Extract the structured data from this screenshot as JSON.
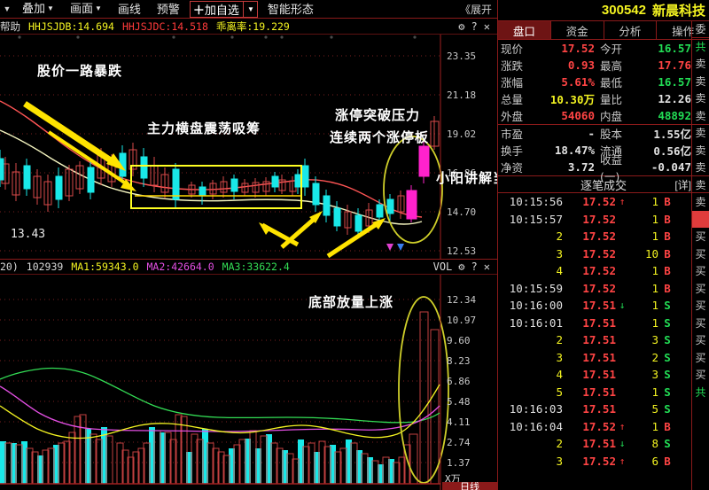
{
  "menu": {
    "left_caret": "▼",
    "items": [
      {
        "label": "叠加",
        "caret": "▼"
      },
      {
        "label": "画面",
        "caret": "▼"
      },
      {
        "label": "画线",
        "caret": ""
      },
      {
        "label": "预警",
        "caret": ""
      }
    ],
    "add_favorite": {
      "plus": "＋",
      "label": "加自选",
      "dropdown": "▼"
    },
    "smart_pattern": "智能形态",
    "expand": "《展开"
  },
  "indicator_line": {
    "help": "帮助",
    "items": [
      {
        "text": "HHJSJDB:14.694",
        "color": "yellow"
      },
      {
        "text": "HHJSJDC:14.518",
        "color": "red"
      },
      {
        "text": "乖离率:19.229",
        "color": "yellow"
      }
    ],
    "tools": [
      "gear-icon",
      "?",
      "✕"
    ]
  },
  "volume_header": {
    "period": "20)",
    "value": "102939",
    "ma1": "MA1:59343.0",
    "ma2": "MA2:42664.0",
    "ma3": "MA3:33622.4",
    "label": "VOL",
    "tools": [
      "gear-icon",
      "?",
      "✕"
    ]
  },
  "price_axis": [
    "23.35",
    "21.18",
    "19.02",
    "16.86",
    "14.70",
    "12.53"
  ],
  "volume_axis": [
    "12.34",
    "10.97",
    "9.60",
    "8.23",
    "6.86",
    "5.48",
    "4.11",
    "2.74",
    "1.37"
  ],
  "volume_axis_unit": "X万",
  "annotations": {
    "crash": "股价一路暴跌",
    "accumulation": "主力横盘震荡吸筹",
    "breakout_line1": "涨停突破压力",
    "breakout_line2": "连续两个涨停板",
    "bottom_volume": "底部放量上涨",
    "price_tag": "13.43",
    "watermark": "小阳讲解当日"
  },
  "day_tab": "日线",
  "right": {
    "stock": {
      "code": "300542",
      "name": "新晨科技"
    },
    "tabs": [
      {
        "label": "盘口",
        "active": true
      },
      {
        "label": "资金",
        "active": false
      },
      {
        "label": "分析",
        "active": false
      },
      {
        "label": "操作",
        "active": false
      }
    ],
    "quote_rows": [
      {
        "label": "现价",
        "value": "17.52",
        "vcolor": "red",
        "label2": "今开",
        "value2": "16.57",
        "vcolor2": "green"
      },
      {
        "label": "涨跌",
        "value": "0.93",
        "vcolor": "red",
        "label2": "最高",
        "value2": "17.76",
        "vcolor2": "red"
      },
      {
        "label": "涨幅",
        "value": "5.61%",
        "vcolor": "red",
        "label2": "最低",
        "value2": "16.57",
        "vcolor2": "green"
      },
      {
        "label": "总量",
        "value": "10.30万",
        "vcolor": "yellow",
        "label2": "量比",
        "value2": "12.26",
        "vcolor2": "white"
      },
      {
        "label": "外盘",
        "value": "54060",
        "vcolor": "red",
        "label2": "内盘",
        "value2": "48892",
        "vcolor2": "green"
      }
    ],
    "quote_rows2": [
      {
        "label": "市盈",
        "value": "-",
        "vcolor": "white",
        "label2": "股本",
        "value2": "1.55亿",
        "vcolor2": "white"
      },
      {
        "label": "换手",
        "value": "18.47%",
        "vcolor": "white",
        "label2": "流通",
        "value2": "0.56亿",
        "vcolor2": "white"
      },
      {
        "label": "净资",
        "value": "3.72",
        "vcolor": "white",
        "label2": "收益(一)",
        "value2": "-0.047",
        "vcolor2": "white"
      }
    ],
    "ticks_title": "逐笔成交",
    "ticks_detail": "[详]",
    "ticks": [
      {
        "time": "10:15:56",
        "is_seq": false,
        "price": "17.52",
        "arrow": "up",
        "vol": "1",
        "bs": "B"
      },
      {
        "time": "10:15:57",
        "is_seq": false,
        "price": "17.52",
        "arrow": "",
        "vol": "1",
        "bs": "B"
      },
      {
        "time": "2",
        "is_seq": true,
        "price": "17.52",
        "arrow": "",
        "vol": "1",
        "bs": "B"
      },
      {
        "time": "3",
        "is_seq": true,
        "price": "17.52",
        "arrow": "",
        "vol": "10",
        "bs": "B"
      },
      {
        "time": "4",
        "is_seq": true,
        "price": "17.52",
        "arrow": "",
        "vol": "1",
        "bs": "B"
      },
      {
        "time": "10:15:59",
        "is_seq": false,
        "price": "17.52",
        "arrow": "",
        "vol": "1",
        "bs": "B"
      },
      {
        "time": "10:16:00",
        "is_seq": false,
        "price": "17.51",
        "arrow": "down",
        "vol": "1",
        "bs": "S"
      },
      {
        "time": "10:16:01",
        "is_seq": false,
        "price": "17.51",
        "arrow": "",
        "vol": "1",
        "bs": "S"
      },
      {
        "time": "2",
        "is_seq": true,
        "price": "17.51",
        "arrow": "",
        "vol": "3",
        "bs": "S"
      },
      {
        "time": "3",
        "is_seq": true,
        "price": "17.51",
        "arrow": "",
        "vol": "2",
        "bs": "S"
      },
      {
        "time": "4",
        "is_seq": true,
        "price": "17.51",
        "arrow": "",
        "vol": "3",
        "bs": "S"
      },
      {
        "time": "5",
        "is_seq": true,
        "price": "17.51",
        "arrow": "",
        "vol": "1",
        "bs": "S"
      },
      {
        "time": "10:16:03",
        "is_seq": false,
        "price": "17.51",
        "arrow": "",
        "vol": "5",
        "bs": "S"
      },
      {
        "time": "10:16:04",
        "is_seq": false,
        "price": "17.52",
        "arrow": "up",
        "vol": "1",
        "bs": "B"
      },
      {
        "time": "2",
        "is_seq": true,
        "price": "17.51",
        "arrow": "down",
        "vol": "8",
        "bs": "S"
      },
      {
        "time": "3",
        "is_seq": true,
        "price": "17.52",
        "arrow": "up",
        "vol": "6",
        "bs": "B"
      }
    ],
    "orderbook_strip": [
      "委",
      "共",
      "卖",
      "卖",
      "卖",
      "卖",
      "卖",
      "卖",
      "卖",
      "卖",
      "卖",
      "",
      "买",
      "买",
      "买",
      "买",
      "买",
      "买",
      "买",
      "买",
      "买",
      "共"
    ]
  },
  "chart_data": {
    "type": "line",
    "title": "300542 新晨科技 日线",
    "price_panel": {
      "ylim": [
        11.8,
        24.2
      ],
      "yticks": [
        23.35,
        21.18,
        19.02,
        16.86,
        14.7,
        12.53
      ],
      "ma_lines": [
        "MA-red",
        "MA-white"
      ],
      "pattern": "downtrend then consolidation then two limit-up breakouts"
    },
    "volume_panel": {
      "ylim": [
        0,
        13.0
      ],
      "yticks": [
        12.34,
        10.97,
        9.6,
        8.23,
        6.86,
        5.48,
        4.11,
        2.74,
        1.37
      ],
      "unit": "X万",
      "ma_lines": [
        "MA1-yellow",
        "MA2-magenta",
        "MA3-green"
      ]
    }
  }
}
